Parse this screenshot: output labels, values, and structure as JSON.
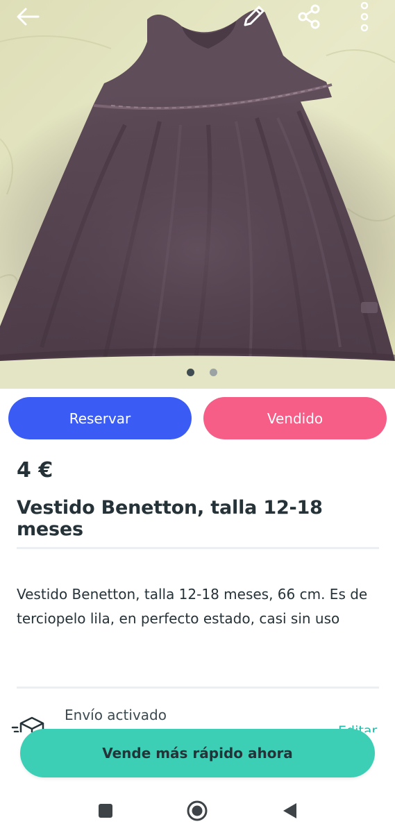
{
  "toolbar": {
    "back_icon": "arrow-left-icon",
    "edit_icon": "pencil-icon",
    "share_icon": "share-icon",
    "more_icon": "more-vertical-icon",
    "icon_color": "#ffffff"
  },
  "gallery": {
    "photo": "purple velvet baby dress",
    "page_count": 2,
    "current_page": 1
  },
  "actions": {
    "reserve_label": "Reservar",
    "sold_label": "Vendido",
    "reserve_color": "#3a5cf5",
    "sold_color": "#f65d87"
  },
  "item": {
    "price": "4 €",
    "title": "Vestido Benetton, talla 12-18 meses",
    "description": "Vestido Benetton, talla 12-18 meses, 66 cm. Es de terciopelo lila, en perfecto estado, casi sin uso"
  },
  "shipping": {
    "icon": "shipping-box-icon",
    "label": "Envío activado",
    "edit_label": "Editar",
    "accent_color": "#13c1ac"
  },
  "promo": {
    "cta_label": "Vende más rápido ahora",
    "cta_color": "#3ccfb5"
  },
  "system_nav": {
    "recents_icon": "square-icon",
    "home_icon": "circle-icon",
    "back_icon": "triangle-back-icon"
  }
}
